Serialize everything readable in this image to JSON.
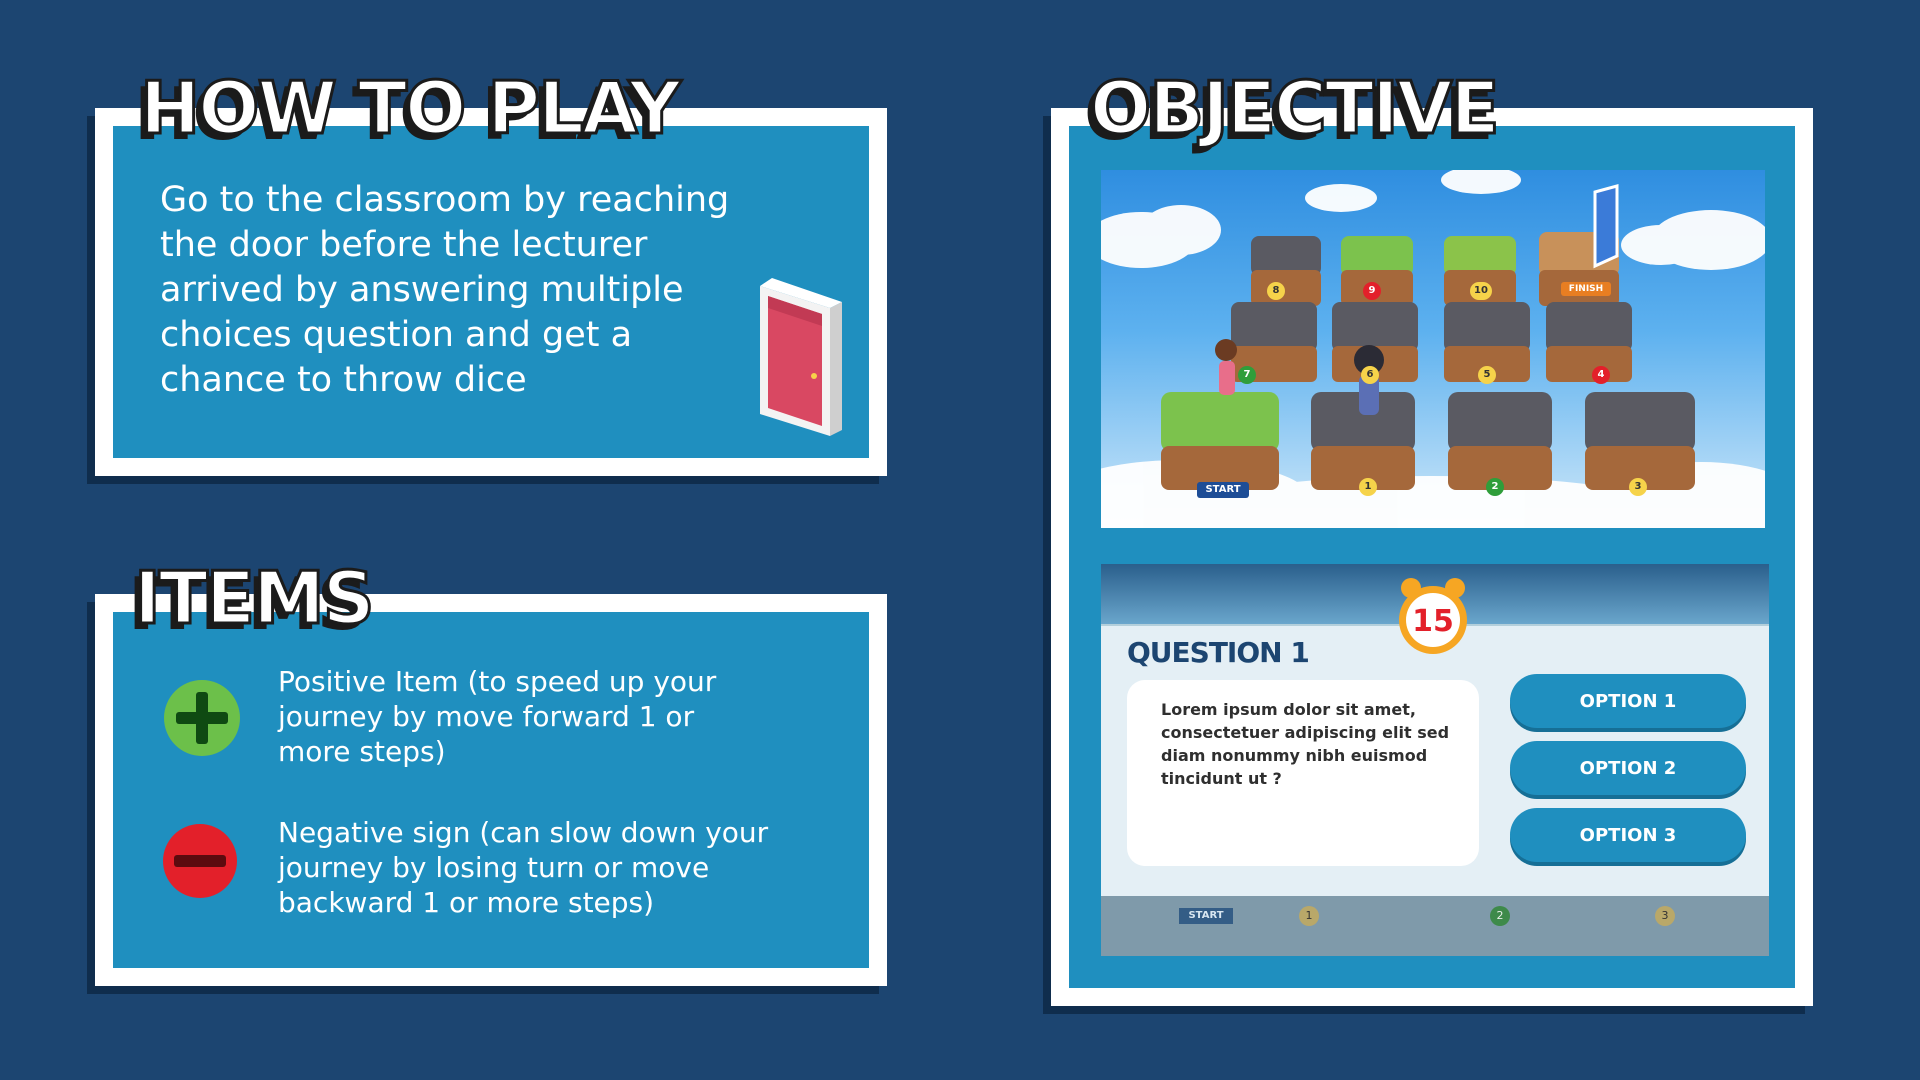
{
  "how_to_play": {
    "heading": "HOW TO PLAY",
    "lines": [
      "Go to the classroom by reaching",
      "the door before the lecturer",
      "arrived by answering multiple",
      "choices question and get a",
      "chance to throw dice"
    ]
  },
  "items": {
    "heading": "ITEMS",
    "positive": {
      "lines": [
        "Positive Item (to speed up your",
        "journey by move forward 1 or",
        "more steps)"
      ],
      "color": "#6cc04a"
    },
    "negative": {
      "lines": [
        "Negative sign (can slow down your",
        "journey by losing turn or move",
        "backward 1 or more steps)"
      ],
      "color": "#e3202a"
    }
  },
  "objective": {
    "heading": "OBJECTIVE",
    "board": {
      "start_label": "START",
      "finish_label": "FINISH",
      "tile_numbers": [
        "1",
        "2",
        "3",
        "4",
        "5",
        "6",
        "7",
        "8",
        "9",
        "10"
      ]
    },
    "quiz": {
      "title": "QUESTION 1",
      "timer": "15",
      "question_lines": [
        "Lorem ipsum dolor sit amet,",
        "consectetuer adipiscing elit sed",
        "diam nonummy nibh euismod",
        "tincidunt ut ?"
      ],
      "options": [
        "OPTION 1",
        "OPTION 2",
        "OPTION 3"
      ],
      "strip": {
        "start_label": "START",
        "numbers": [
          "1",
          "2",
          "3"
        ]
      }
    }
  },
  "colors": {
    "background": "#1c4571",
    "panel": "#1f8fbf",
    "option_button": "#1f8fbf",
    "quiz_title": "#1c4571"
  }
}
